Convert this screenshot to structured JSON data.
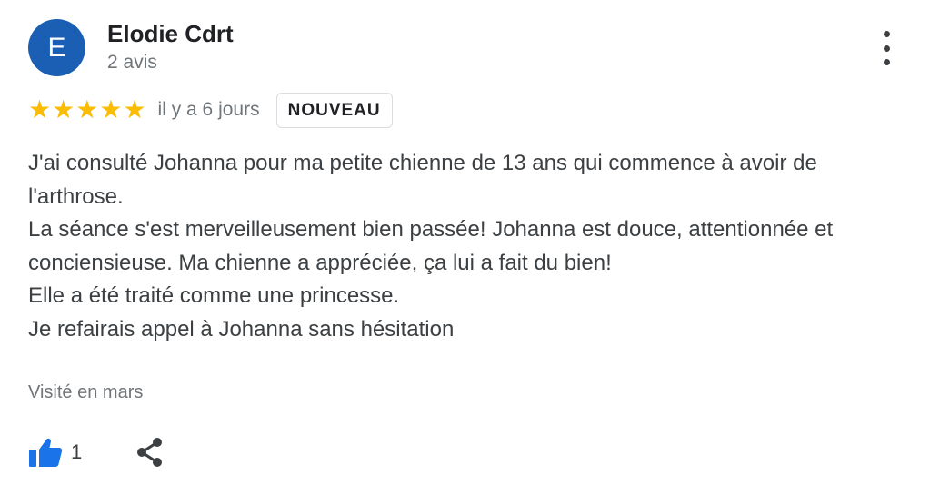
{
  "review": {
    "author": {
      "initial": "E",
      "name": "Elodie Cdrt",
      "review_count": "2 avis"
    },
    "rating": 5,
    "date": "il y a 6 jours",
    "badge": "NOUVEAU",
    "text_lines": [
      "J'ai consulté Johanna pour ma petite chienne de 13 ans qui commence à avoir de l'arthrose.",
      "La séance s'est merveilleusement bien passée! Johanna est douce, attentionnée et conciensieuse. Ma chienne a appréciée, ça lui a fait du bien!",
      "Elle a été traité comme une princesse.",
      "Je refairais appel à Johanna sans hésitation"
    ],
    "visited": "Visité en mars",
    "likes": "1"
  },
  "icons": {
    "menu": "more-vert-icon",
    "star": "star-icon",
    "like": "thumbs-up-icon",
    "share": "share-icon"
  },
  "colors": {
    "avatar_bg": "#1a5fb4",
    "star": "#fbbc04",
    "like_icon": "#1a73e8",
    "muted_text": "#70757a"
  }
}
